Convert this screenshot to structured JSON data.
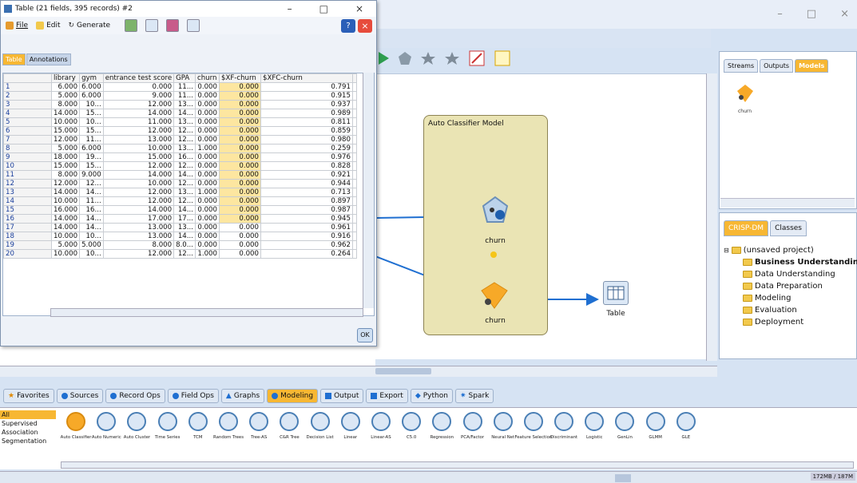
{
  "dialog": {
    "title": "Table (21 fields, 395 records) #2",
    "menu": [
      "File",
      "Edit",
      "Generate"
    ],
    "help_label": "?",
    "close_label": "×",
    "minimize_label": "–",
    "maximize_label": "□",
    "winclose_label": "×",
    "tabs": [
      "Table",
      "Annotations"
    ],
    "columns": [
      "",
      "library",
      "gym",
      "entrance test score",
      "GPA",
      "churn",
      "$XF-churn",
      "$XFC-churn",
      ""
    ],
    "rows": [
      [
        "1",
        "6.000",
        "6.000",
        "0.000",
        "11...",
        "0.000",
        "0.000",
        "0.791"
      ],
      [
        "2",
        "5.000",
        "6.000",
        "9.000",
        "11...",
        "0.000",
        "0.000",
        "0.915"
      ],
      [
        "3",
        "8.000",
        "10...",
        "12.000",
        "13...",
        "0.000",
        "0.000",
        "0.937"
      ],
      [
        "4",
        "14.000",
        "15...",
        "14.000",
        "14...",
        "0.000",
        "0.000",
        "0.989"
      ],
      [
        "5",
        "10.000",
        "10...",
        "11.000",
        "13...",
        "0.000",
        "0.000",
        "0.811"
      ],
      [
        "6",
        "15.000",
        "15...",
        "12.000",
        "12...",
        "0.000",
        "0.000",
        "0.859"
      ],
      [
        "7",
        "12.000",
        "11...",
        "13.000",
        "12...",
        "0.000",
        "0.000",
        "0.980"
      ],
      [
        "8",
        "5.000",
        "6.000",
        "10.000",
        "13...",
        "1.000",
        "0.000",
        "0.259"
      ],
      [
        "9",
        "18.000",
        "19...",
        "15.000",
        "16...",
        "0.000",
        "0.000",
        "0.976"
      ],
      [
        "10",
        "15.000",
        "15...",
        "12.000",
        "12...",
        "0.000",
        "0.000",
        "0.828"
      ],
      [
        "11",
        "8.000",
        "9.000",
        "14.000",
        "14...",
        "0.000",
        "0.000",
        "0.921"
      ],
      [
        "12",
        "12.000",
        "12...",
        "10.000",
        "12...",
        "0.000",
        "0.000",
        "0.944"
      ],
      [
        "13",
        "14.000",
        "14...",
        "12.000",
        "13...",
        "1.000",
        "0.000",
        "0.713"
      ],
      [
        "14",
        "10.000",
        "11...",
        "12.000",
        "12...",
        "0.000",
        "0.000",
        "0.897"
      ],
      [
        "15",
        "16.000",
        "16...",
        "14.000",
        "14...",
        "0.000",
        "0.000",
        "0.987"
      ],
      [
        "16",
        "14.000",
        "14...",
        "17.000",
        "17...",
        "0.000",
        "0.000",
        "0.945"
      ],
      [
        "17",
        "14.000",
        "14...",
        "13.000",
        "13...",
        "0.000",
        "0.000",
        "0.961"
      ],
      [
        "18",
        "10.000",
        "10...",
        "13.000",
        "14...",
        "0.000",
        "0.000",
        "0.916"
      ],
      [
        "19",
        "5.000",
        "5.000",
        "8.000",
        "8.0...",
        "0.000",
        "0.000",
        "0.962"
      ],
      [
        "20",
        "10.000",
        "10...",
        "12.000",
        "12...",
        "1.000",
        "0.000",
        "0.264"
      ]
    ],
    "ok_label": "OK"
  },
  "canvas": {
    "supernode_title": "Auto Classifier Model",
    "node1_label": "churn",
    "node2_label": "churn",
    "table_label": "Table"
  },
  "right_panel": {
    "tabs": [
      "Streams",
      "Outputs",
      "Models"
    ],
    "model_label": "churn",
    "crisp_tabs": [
      "CRISP-DM",
      "Classes"
    ],
    "tree": [
      "(unsaved project)",
      "Business Understanding",
      "Data Understanding",
      "Data Preparation",
      "Modeling",
      "Evaluation",
      "Deployment"
    ]
  },
  "palette": {
    "tabs": [
      "Favorites",
      "Sources",
      "Record Ops",
      "Field Ops",
      "Graphs",
      "Modeling",
      "Output",
      "Export",
      "Python",
      "Spark"
    ],
    "categories": [
      "All",
      "Supervised",
      "Association",
      "Segmentation"
    ],
    "nodes": [
      "Auto Classifier",
      "Auto Numeric",
      "Auto Cluster",
      "Time Series",
      "TCM",
      "Random Trees",
      "Tree-AS",
      "C&R Tree",
      "Decision List",
      "Linear",
      "Linear-AS",
      "C5.0",
      "Regression",
      "PCA/Factor",
      "Neural Net",
      "Feature Selection",
      "Discriminant",
      "Logistic",
      "GenLin",
      "GLMM",
      "GLE"
    ]
  },
  "status": {
    "memory": "172MB / 187M"
  },
  "colors": {
    "accent": "#f7b733",
    "link": "#1f6fd1",
    "supernode": "#eae4b4"
  }
}
